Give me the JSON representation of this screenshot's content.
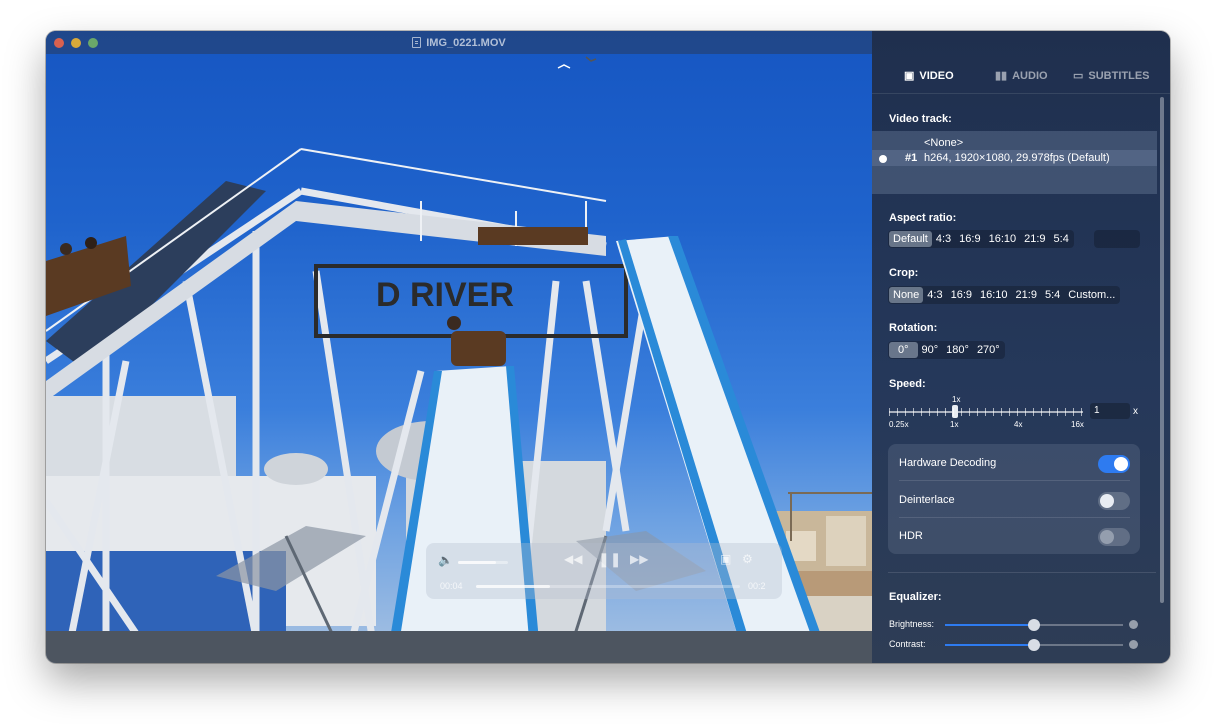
{
  "window": {
    "title": "IMG_0221.MOV"
  },
  "player": {
    "time_elapsed": "00:04",
    "time_remaining": "00:2",
    "progress_fraction": 0.28,
    "volume_fraction": 0.75,
    "sign_text": "D RIVER"
  },
  "tabs": [
    {
      "label": "VIDEO",
      "icon": "image-icon",
      "active": true
    },
    {
      "label": "AUDIO",
      "icon": "waveform-icon",
      "active": false
    },
    {
      "label": "SUBTITLES",
      "icon": "speech-bubble-icon",
      "active": false
    }
  ],
  "video_track": {
    "label": "Video track:",
    "none_option": "<None>",
    "tracks": [
      {
        "number": "#1",
        "description": "h264, 1920×1080, 29.978fps (Default)",
        "selected": true
      }
    ]
  },
  "aspect_ratio": {
    "label": "Aspect ratio:",
    "options": [
      "Default",
      "4:3",
      "16:9",
      "16:10",
      "21:9",
      "5:4"
    ],
    "selected": "Default",
    "custom_value": ""
  },
  "crop": {
    "label": "Crop:",
    "options": [
      "None",
      "4:3",
      "16:9",
      "16:10",
      "21:9",
      "5:4",
      "Custom..."
    ],
    "selected": "None"
  },
  "rotation": {
    "label": "Rotation:",
    "options": [
      "0°",
      "90°",
      "180°",
      "270°"
    ],
    "selected": "0°"
  },
  "speed": {
    "label": "Speed:",
    "current_marker": "1x",
    "tick_labels": [
      "0.25x",
      "1x",
      "4x",
      "16x"
    ],
    "value": "1",
    "unit": "x"
  },
  "toggles": [
    {
      "label": "Hardware Decoding",
      "on": true
    },
    {
      "label": "Deinterlace",
      "on": false
    },
    {
      "label": "HDR",
      "on": false,
      "disabled": true
    }
  ],
  "equalizer": {
    "label": "Equalizer:",
    "rows": [
      {
        "label": "Brightness:",
        "value": 0.5
      },
      {
        "label": "Contrast:",
        "value": 0.5
      }
    ]
  },
  "colors": {
    "accent": "#2e7bf0",
    "sidebar_bg": "#25385a",
    "sky": "#1f63cc"
  }
}
